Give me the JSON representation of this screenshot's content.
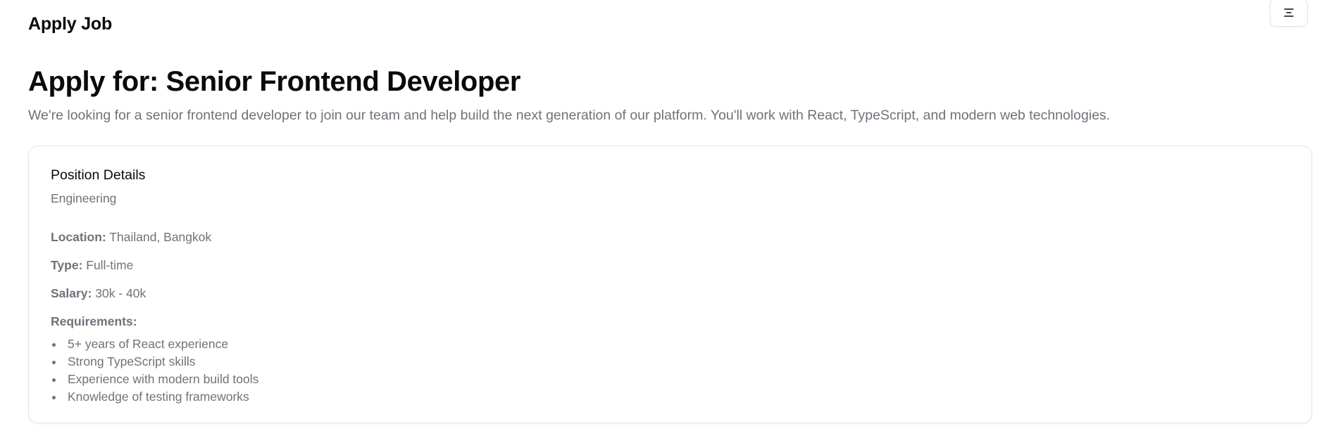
{
  "header": {
    "app_title": "Apply Job",
    "menu_icon": "menu-icon"
  },
  "job": {
    "headline": "Apply for: Senior Frontend Developer",
    "description": "We're looking for a senior frontend developer to join our team and help build the next generation of our platform. You'll work with React, TypeScript, and modern web technologies."
  },
  "details": {
    "title": "Position Details",
    "department": "Engineering",
    "location_label": "Location:",
    "location_value": "Thailand, Bangkok",
    "type_label": "Type:",
    "type_value": "Full-time",
    "salary_label": "Salary:",
    "salary_value": "30k - 40k",
    "requirements_label": "Requirements:",
    "requirements": [
      "5+ years of React experience",
      "Strong TypeScript skills",
      "Experience with modern build tools",
      "Knowledge of testing frameworks"
    ]
  },
  "colors": {
    "text": "#0a0a0a",
    "muted": "#71717a",
    "border": "#e4e4e7",
    "background": "#ffffff"
  }
}
